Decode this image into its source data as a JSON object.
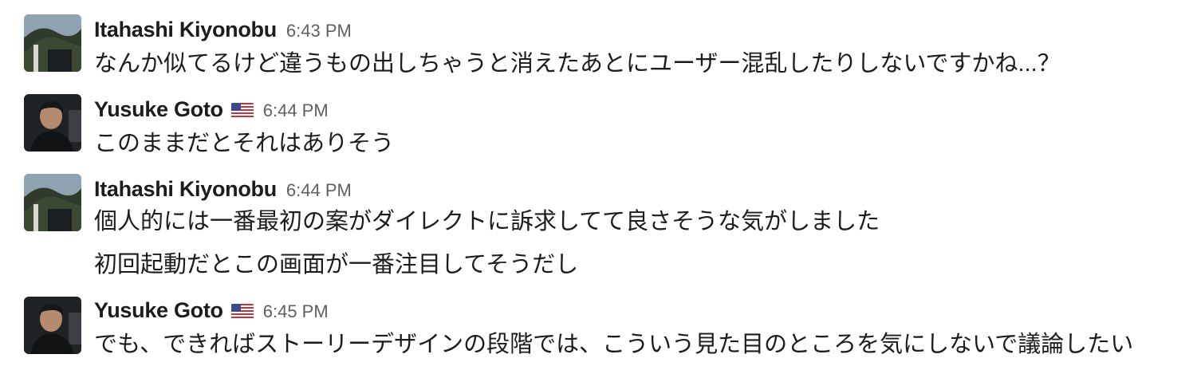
{
  "messages": [
    {
      "author": "Itahashi Kiyonobu",
      "time": "6:43 PM",
      "avatar_icon": "user-avatar-photo",
      "flag": "",
      "lines": [
        "なんか似てるけど違うもの出しちゃうと消えたあとにユーザー混乱したりしないですかね...？"
      ]
    },
    {
      "author": "Yusuke Goto",
      "time": "6:44 PM",
      "avatar_icon": "user-avatar-photo",
      "flag": "us-flag-emoji",
      "lines": [
        "このままだとそれはありそう"
      ]
    },
    {
      "author": "Itahashi Kiyonobu",
      "time": "6:44 PM",
      "avatar_icon": "user-avatar-photo",
      "flag": "",
      "lines": [
        "個人的には一番最初の案がダイレクトに訴求してて良さそうな気がしました",
        "初回起動だとこの画面が一番注目してそうだし"
      ]
    },
    {
      "author": "Yusuke Goto",
      "time": "6:45 PM",
      "avatar_icon": "user-avatar-photo",
      "flag": "us-flag-emoji",
      "lines": [
        "でも、できればストーリーデザインの段階では、こういう見た目のところを気にしないで議論したい"
      ]
    }
  ],
  "colors": {
    "text": "#1d1c1d",
    "timestamp": "#616061",
    "background": "#ffffff"
  }
}
